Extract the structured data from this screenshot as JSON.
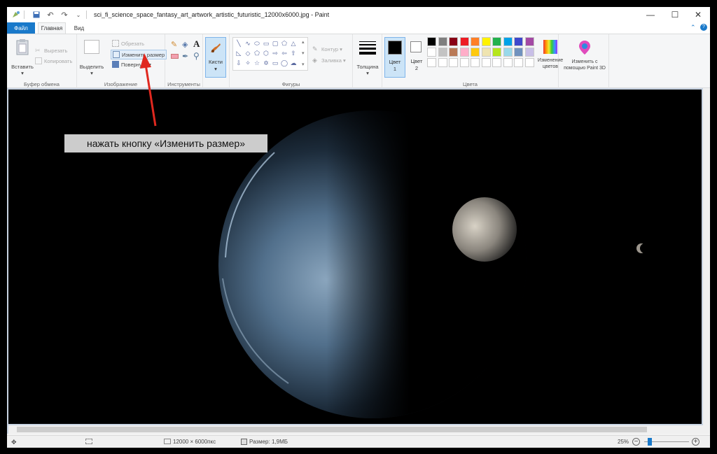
{
  "title_bar": {
    "title": "sci_fi_science_space_fantasy_art_artwork_artistic_futuristic_12000x6000.jpg - Paint",
    "minimize": "—",
    "maximize": "☐",
    "close": "✕"
  },
  "tabs": [
    {
      "label": "Файл"
    },
    {
      "label": "Главная"
    },
    {
      "label": "Вид"
    }
  ],
  "ribbon": {
    "clipboard": {
      "label": "Буфер обмена",
      "paste": "Вставить",
      "cut": "Вырезать",
      "copy": "Копировать"
    },
    "image": {
      "label": "Изображение",
      "select": "Выделить",
      "crop": "Обрезать",
      "resize": "Изменить размер",
      "rotate": "Повернуть"
    },
    "tools": {
      "label": "Инструменты"
    },
    "brushes": "Кисти",
    "shapes": {
      "label": "Фигуры",
      "outline": "Контур",
      "fill": "Заливка"
    },
    "size": "Толщина",
    "colors": {
      "label": "Цвета",
      "color1": "Цвет",
      "color1_num": "1",
      "color2": "Цвет",
      "color2_num": "2",
      "edit_colors_1": "Изменение",
      "edit_colors_2": "цветов",
      "paint3d_1": "Изменить с",
      "paint3d_2": "помощью Paint 3D",
      "palette_row1": [
        "#000000",
        "#7f7f7f",
        "#880015",
        "#ed1c24",
        "#ff7f27",
        "#fff200",
        "#22b14c",
        "#00a2e8",
        "#3f48cc",
        "#a349a4"
      ],
      "palette_row2": [
        "#ffffff",
        "#c3c3c3",
        "#b97a57",
        "#ffaec9",
        "#ffc90e",
        "#efe4b0",
        "#b5e61d",
        "#99d9ea",
        "#7092be",
        "#c8bfe7"
      ]
    }
  },
  "annotation": {
    "text": "нажать кнопку «Изменить размер»"
  },
  "status": {
    "dimensions": "12000 × 6000пкс",
    "filesize": "Размер: 1,9МБ",
    "zoom": "25%"
  }
}
